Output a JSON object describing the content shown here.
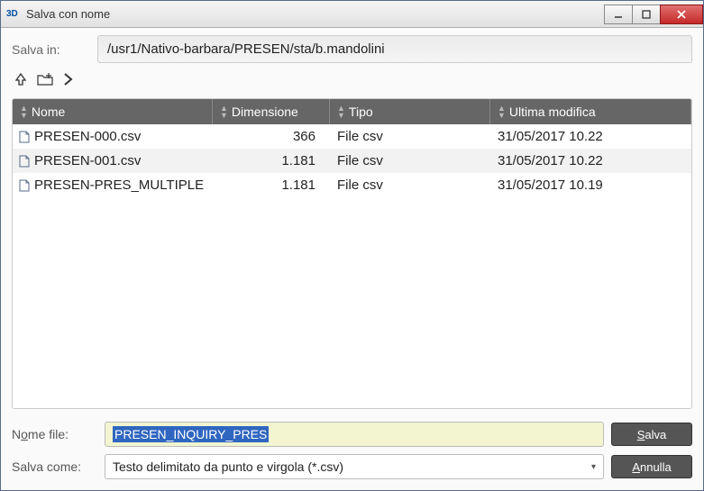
{
  "window": {
    "title": "Salva con nome",
    "app_icon_text": "3D"
  },
  "path": {
    "label": "Salva in:",
    "value": "/usr1/Nativo-barbara/PRESEN/sta/b.mandolini"
  },
  "nav": {
    "up_title": "up",
    "newfolder_title": "new-folder",
    "forward_title": "forward"
  },
  "columns": {
    "name": "Nome",
    "size": "Dimensione",
    "type": "Tipo",
    "modified": "Ultima modifica"
  },
  "files": [
    {
      "name": "PRESEN-000.csv",
      "size": "366",
      "type": "File csv",
      "modified": "31/05/2017 10.22"
    },
    {
      "name": "PRESEN-001.csv",
      "size": "1.181",
      "type": "File csv",
      "modified": "31/05/2017 10.22"
    },
    {
      "name": "PRESEN-PRES_MULTIPLE",
      "size": "1.181",
      "type": "File csv",
      "modified": "31/05/2017 10.19"
    }
  ],
  "filename": {
    "label_pre": "N",
    "label_ul": "o",
    "label_post": "me file:",
    "value": "PRESEN_INQUIRY_PRES"
  },
  "saveas": {
    "label": "Salva come:",
    "value": "Testo delimitato da punto e virgola (*.csv)"
  },
  "buttons": {
    "save_ul": "S",
    "save_post": "alva",
    "cancel_ul": "A",
    "cancel_post": "nnulla"
  }
}
